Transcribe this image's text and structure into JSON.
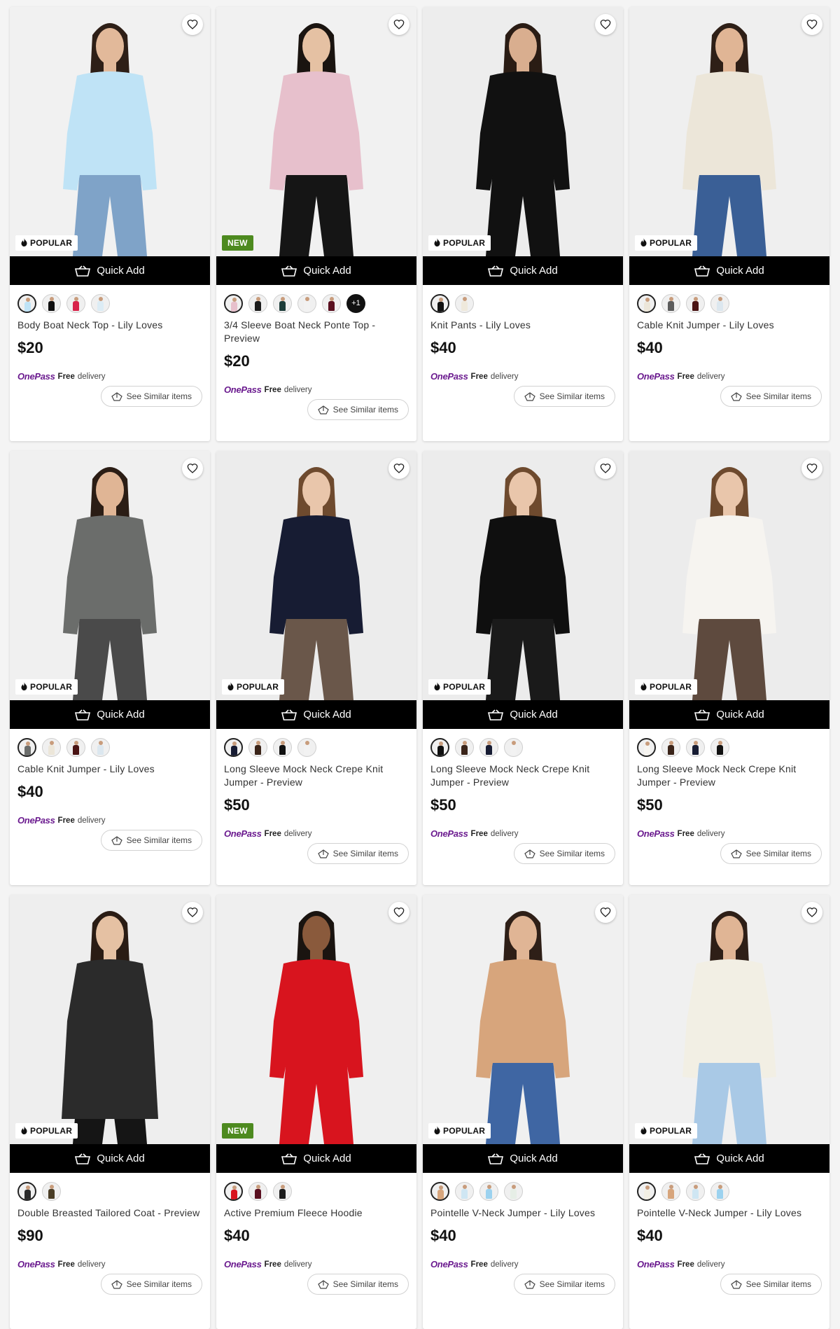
{
  "colors": {
    "quick_add_bg": "#000000",
    "new_badge": "#4d8a1f",
    "onepass": "#6b1b8f"
  },
  "labels": {
    "quick_add": "Quick Add",
    "see_similar": "See Similar items",
    "onepass": "OnePass",
    "free": "Free",
    "delivery": "delivery"
  },
  "products": [
    {
      "badge": "POPULAR",
      "badge_type": "popular",
      "title": "Body Boat Neck Top - Lily Loves",
      "price": "$20",
      "bg": "#f1f1f1",
      "top": "#bfe3f6",
      "bottom": "#7fa3c8",
      "skin": "#e2b99a",
      "hair": "#2e1f17",
      "long": false,
      "swatches": [
        [
          "#bfe3f6",
          true
        ],
        [
          "#111111",
          false
        ],
        [
          "#d8234a",
          false
        ],
        [
          "#dcecf5",
          false
        ]
      ],
      "more": ""
    },
    {
      "badge": "NEW",
      "badge_type": "new",
      "title": "3/4 Sleeve Boat Neck Ponte Top - Preview",
      "price": "$20",
      "bg": "#f1f1f1",
      "top": "#e7c0cc",
      "bottom": "#151515",
      "skin": "#e5c1a3",
      "hair": "#1a1410",
      "long": false,
      "swatches": [
        [
          "#e7c0cc",
          true
        ],
        [
          "#1c1c1c",
          false
        ],
        [
          "#1d3d3a",
          false
        ],
        [
          "#f2f2f2",
          false
        ],
        [
          "#5a1020",
          false
        ]
      ],
      "more": "+1"
    },
    {
      "badge": "POPULAR",
      "badge_type": "popular",
      "title": "Knit Pants - Lily Loves",
      "price": "$40",
      "bg": "#ededed",
      "top": "#111111",
      "bottom": "#111111",
      "skin": "#d9ae8f",
      "hair": "#2a1c14",
      "long": false,
      "swatches": [
        [
          "#111111",
          true
        ],
        [
          "#efe9dc",
          false
        ]
      ],
      "more": ""
    },
    {
      "badge": "POPULAR",
      "badge_type": "popular",
      "title": "Cable Knit Jumper - Lily Loves",
      "price": "$40",
      "bg": "#efefef",
      "top": "#ece6d9",
      "bottom": "#3a5f96",
      "skin": "#e0b595",
      "hair": "#2e1f17",
      "long": false,
      "swatches": [
        [
          "#ece6d9",
          true
        ],
        [
          "#5c5c5c",
          false
        ],
        [
          "#4a1414",
          false
        ],
        [
          "#dce7ef",
          false
        ]
      ],
      "more": ""
    },
    {
      "badge": "POPULAR",
      "badge_type": "popular",
      "title": "Cable Knit Jumper - Lily Loves",
      "price": "$40",
      "bg": "#f0f0f0",
      "top": "#6b6d6b",
      "bottom": "#4a4a4a",
      "skin": "#e0b595",
      "hair": "#2b1d15",
      "long": false,
      "swatches": [
        [
          "#6b6d6b",
          true
        ],
        [
          "#ece6d9",
          false
        ],
        [
          "#4a1414",
          false
        ],
        [
          "#dce7ef",
          false
        ]
      ],
      "more": ""
    },
    {
      "badge": "POPULAR",
      "badge_type": "popular",
      "title": "Long Sleeve Mock Neck Crepe Knit Jumper - Preview",
      "price": "$50",
      "bg": "#ececec",
      "top": "#171c33",
      "bottom": "#6a574a",
      "skin": "#e9c6ab",
      "hair": "#6e4a2e",
      "long": false,
      "swatches": [
        [
          "#171c33",
          true
        ],
        [
          "#3a2419",
          false
        ],
        [
          "#111111",
          false
        ],
        [
          "#f2f2f2",
          false
        ]
      ],
      "more": ""
    },
    {
      "badge": "POPULAR",
      "badge_type": "popular",
      "title": "Long Sleeve Mock Neck Crepe Knit Jumper - Preview",
      "price": "$50",
      "bg": "#ececec",
      "top": "#0f0f0f",
      "bottom": "#1a1a1a",
      "skin": "#e9c6ab",
      "hair": "#6e4a2e",
      "long": false,
      "swatches": [
        [
          "#0f0f0f",
          true
        ],
        [
          "#3a2419",
          false
        ],
        [
          "#171c33",
          false
        ],
        [
          "#f2f2f2",
          false
        ]
      ],
      "more": ""
    },
    {
      "badge": "POPULAR",
      "badge_type": "popular",
      "title": "Long Sleeve Mock Neck Crepe Knit Jumper - Preview",
      "price": "$50",
      "bg": "#ececec",
      "top": "#f6f4f0",
      "bottom": "#5e4a3e",
      "skin": "#e9c6ab",
      "hair": "#6e4a2e",
      "long": false,
      "swatches": [
        [
          "#f6f4f0",
          true
        ],
        [
          "#3a2419",
          false
        ],
        [
          "#171c33",
          false
        ],
        [
          "#111111",
          false
        ]
      ],
      "more": ""
    },
    {
      "badge": "POPULAR",
      "badge_type": "popular",
      "title": "Double Breasted Tailored Coat - Preview",
      "price": "$90",
      "bg": "#eeeeee",
      "top": "#2b2b2b",
      "bottom": "#151515",
      "skin": "#e5c1a3",
      "hair": "#2a1c14",
      "long": true,
      "swatches": [
        [
          "#2b2b2b",
          true
        ],
        [
          "#4a3d26",
          false
        ]
      ],
      "more": ""
    },
    {
      "badge": "NEW",
      "badge_type": "new",
      "title": "Active Premium Fleece Hoodie",
      "price": "$40",
      "bg": "#efefef",
      "top": "#d8141e",
      "bottom": "#d8141e",
      "skin": "#8a5a3c",
      "hair": "#1a1410",
      "long": false,
      "swatches": [
        [
          "#d8141e",
          true
        ],
        [
          "#5a1020",
          false
        ],
        [
          "#1c1c1c",
          false
        ]
      ],
      "more": ""
    },
    {
      "badge": "POPULAR",
      "badge_type": "popular",
      "title": "Pointelle V-Neck Jumper - Lily Loves",
      "price": "$40",
      "bg": "#f0f0f0",
      "top": "#d7a57c",
      "bottom": "#3f66a3",
      "skin": "#e0b595",
      "hair": "#2e1f17",
      "long": false,
      "swatches": [
        [
          "#d7a57c",
          true
        ],
        [
          "#cfe6f3",
          false
        ],
        [
          "#9cd2ef",
          false
        ],
        [
          "#e6eee6",
          false
        ]
      ],
      "more": ""
    },
    {
      "badge": "POPULAR",
      "badge_type": "popular",
      "title": "Pointelle V-Neck Jumper - Lily Loves",
      "price": "$40",
      "bg": "#f0f0f0",
      "top": "#f2efe4",
      "bottom": "#a9c9e6",
      "skin": "#e0b595",
      "hair": "#2e1f17",
      "long": false,
      "swatches": [
        [
          "#f2efe4",
          true
        ],
        [
          "#d7a57c",
          false
        ],
        [
          "#cfe6f3",
          false
        ],
        [
          "#9cd2ef",
          false
        ]
      ],
      "more": ""
    }
  ]
}
